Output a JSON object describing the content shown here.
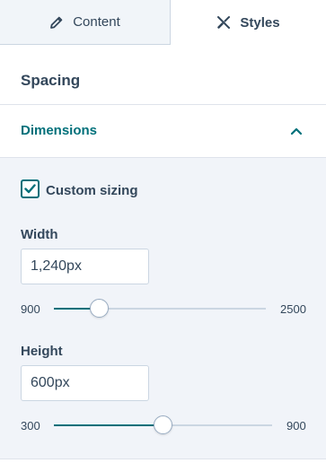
{
  "tabs": {
    "content_label": "Content",
    "styles_label": "Styles",
    "active": "Styles"
  },
  "sections": {
    "spacing_title": "Spacing",
    "dimensions_title": "Dimensions",
    "dimensions_expanded": true
  },
  "custom_sizing": {
    "label": "Custom sizing",
    "checked": true
  },
  "width": {
    "label": "Width",
    "value": "1,240px",
    "min_label": "900",
    "max_label": "2500",
    "min": 900,
    "max": 2500,
    "current": 1240
  },
  "height": {
    "label": "Height",
    "value": "600px",
    "min_label": "300",
    "max_label": "900",
    "min": 300,
    "max": 900,
    "current": 600
  },
  "colors": {
    "accent": "#00707a",
    "text": "#33475b",
    "panel_bg": "#f1f4f9"
  }
}
